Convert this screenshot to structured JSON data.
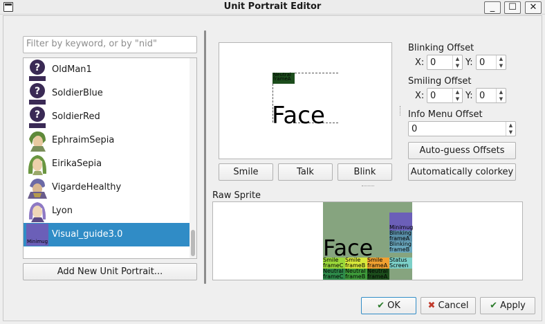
{
  "window": {
    "title": "Unit Portrait Editor",
    "minimize": "_",
    "maximize": "☐",
    "close": "✕"
  },
  "filter": {
    "placeholder": "Filter by keyword, or by \"nid\""
  },
  "portraits": [
    {
      "name": "OldMan1",
      "thumb": "unknown"
    },
    {
      "name": "SoldierBlue",
      "thumb": "unknown"
    },
    {
      "name": "SoldierRed",
      "thumb": "unknown"
    },
    {
      "name": "EphraimSepia",
      "thumb": "green-hair"
    },
    {
      "name": "EirikaSepia",
      "thumb": "green-hair"
    },
    {
      "name": "VigardeHealthy",
      "thumb": "armor"
    },
    {
      "name": "Lyon",
      "thumb": "purple-hair"
    },
    {
      "name": "Visual_guide3.0",
      "thumb": "minimug",
      "thumb_text": "Minimug",
      "selected": true
    }
  ],
  "add_portrait_label": "Add New Unit Portrait...",
  "preview": {
    "face_text": "Face",
    "frame_label_1": "Neutral",
    "frame_label_2": "frameA"
  },
  "preview_buttons": {
    "smile": "Smile",
    "talk": "Talk",
    "blink": "Blink"
  },
  "blinking": {
    "label": "Blinking Offset",
    "x_label": "X:",
    "x": "0",
    "y_label": "Y:",
    "y": "0"
  },
  "smiling": {
    "label": "Smiling Offset",
    "x_label": "X:",
    "x": "0",
    "y_label": "Y:",
    "y": "0"
  },
  "info_menu": {
    "label": "Info Menu Offset",
    "value": "0"
  },
  "auto_guess_label": "Auto-guess Offsets",
  "colorkey_label": "Automatically colorkey",
  "raw_sprite": {
    "label": "Raw Sprite",
    "face_text": "Face",
    "cells": {
      "minimug": "Minimug",
      "blinking_a_1": "Blinking",
      "blinking_a_2": "frameA",
      "blinking_b_1": "Blinking",
      "blinking_b_2": "frameB",
      "status_1": "Status",
      "status_2": "Screen",
      "smile_c_1": "Smile",
      "smile_c_2": "frameC",
      "smile_b_1": "Smile",
      "smile_b_2": "frameB",
      "smile_a_1": "Smile",
      "smile_a_2": "frameA",
      "neutral_c_1": "Neutral",
      "neutral_c_2": "frameC",
      "neutral_b_1": "Neutral",
      "neutral_b_2": "frameB",
      "neutral_a_1": "Neutral",
      "neutral_a_2": "frameA"
    }
  },
  "dialog_buttons": {
    "ok": "OK",
    "cancel": "Cancel",
    "apply": "Apply"
  },
  "colors": {
    "selection": "#308cc6",
    "sprite_bg": "#86a47f",
    "minimug": "#6b5fb8"
  }
}
